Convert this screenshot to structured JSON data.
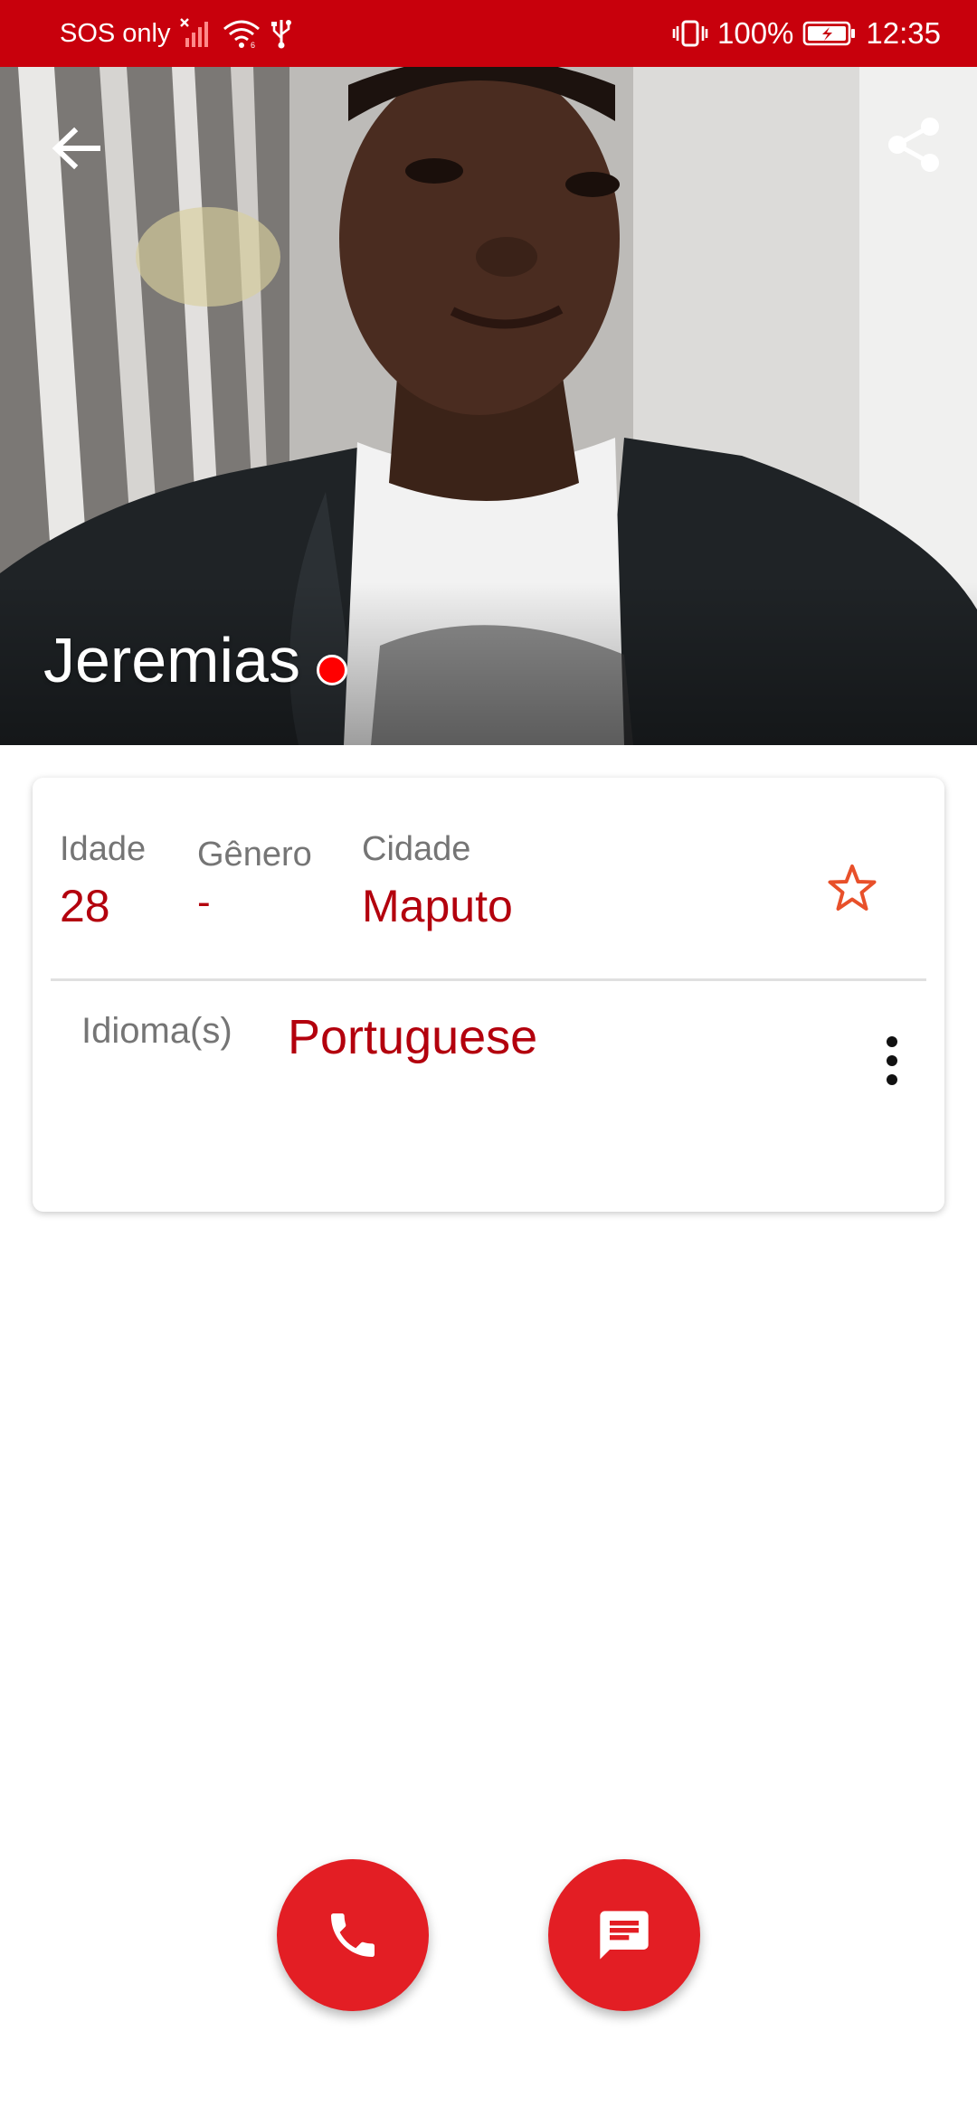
{
  "status_bar": {
    "carrier_text": "SOS only",
    "battery_percent": "100%",
    "time": "12:35",
    "icons": [
      "no-signal-icon",
      "wifi-icon",
      "usb-icon",
      "vibrate-icon",
      "battery-charging-icon"
    ]
  },
  "header": {
    "back_icon": "arrow-back-icon",
    "share_icon": "share-icon",
    "profile_name": "Jeremias",
    "online_status_color": "#ff0000"
  },
  "profile_card": {
    "age": {
      "label": "Idade",
      "value": "28"
    },
    "gender": {
      "label": "Gênero",
      "value": "-"
    },
    "city": {
      "label": "Cidade",
      "value": "Maputo"
    },
    "favorite_icon": "star-outline-icon",
    "languages": {
      "label": "Idioma(s)",
      "value": "Portuguese"
    },
    "more_icon": "more-vertical-icon"
  },
  "actions": {
    "call_icon": "phone-icon",
    "message_icon": "chat-icon",
    "accent_color": "#e31e24"
  },
  "colors": {
    "status_bar": "#c8000c",
    "value_text": "#b3000d",
    "label_text": "#757575",
    "star_outline": "#e8502a"
  }
}
